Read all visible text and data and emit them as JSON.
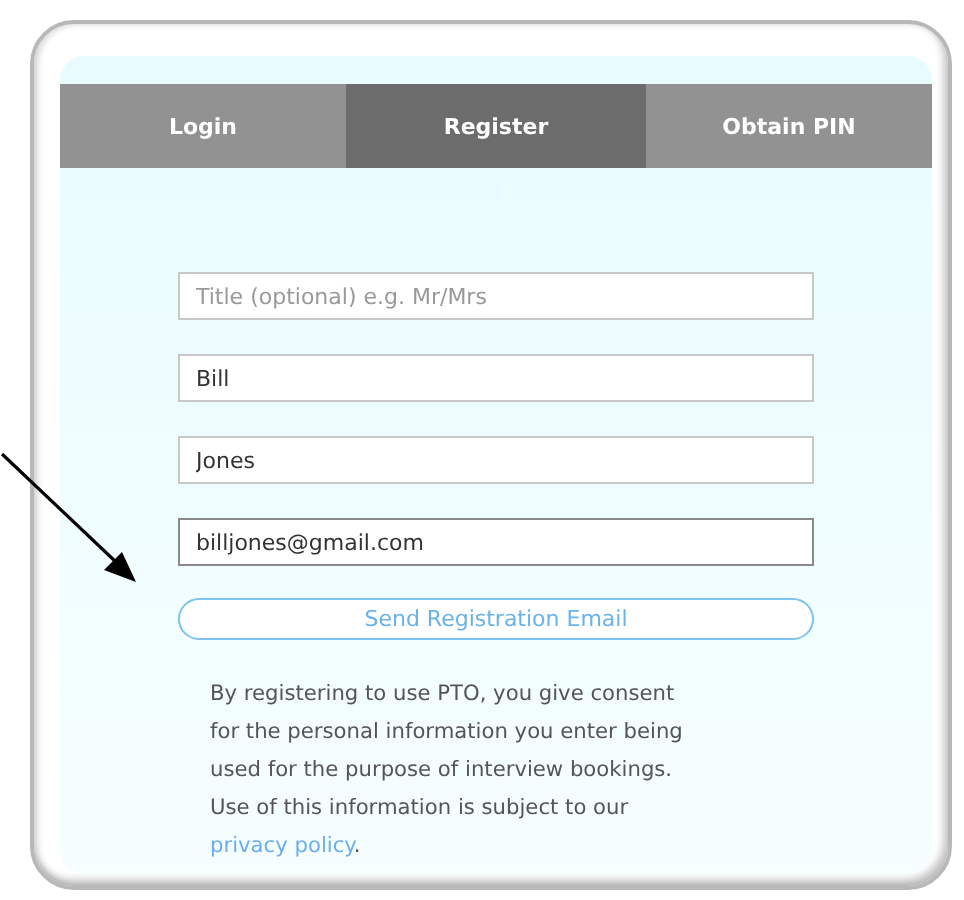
{
  "tabs": [
    {
      "label": "Login",
      "selected": false
    },
    {
      "label": "Register",
      "selected": true
    },
    {
      "label": "Obtain PIN",
      "selected": false
    }
  ],
  "fields": [
    {
      "placeholder": "Title (optional) e.g. Mr/Mrs",
      "focused": false
    },
    {
      "value": "Bill",
      "focused": false
    },
    {
      "value": "Jones",
      "focused": false
    },
    {
      "value": "billjones@gmail.com",
      "focused": true
    }
  ],
  "submit_button": "Send Registration Email",
  "consent": {
    "lines": [
      "By registering to use PTO, you give consent",
      "for the personal information you enter being",
      "used for the purpose of interview bookings.",
      "Use of this information is subject to our"
    ],
    "link": "privacy policy",
    "after_link": "."
  }
}
